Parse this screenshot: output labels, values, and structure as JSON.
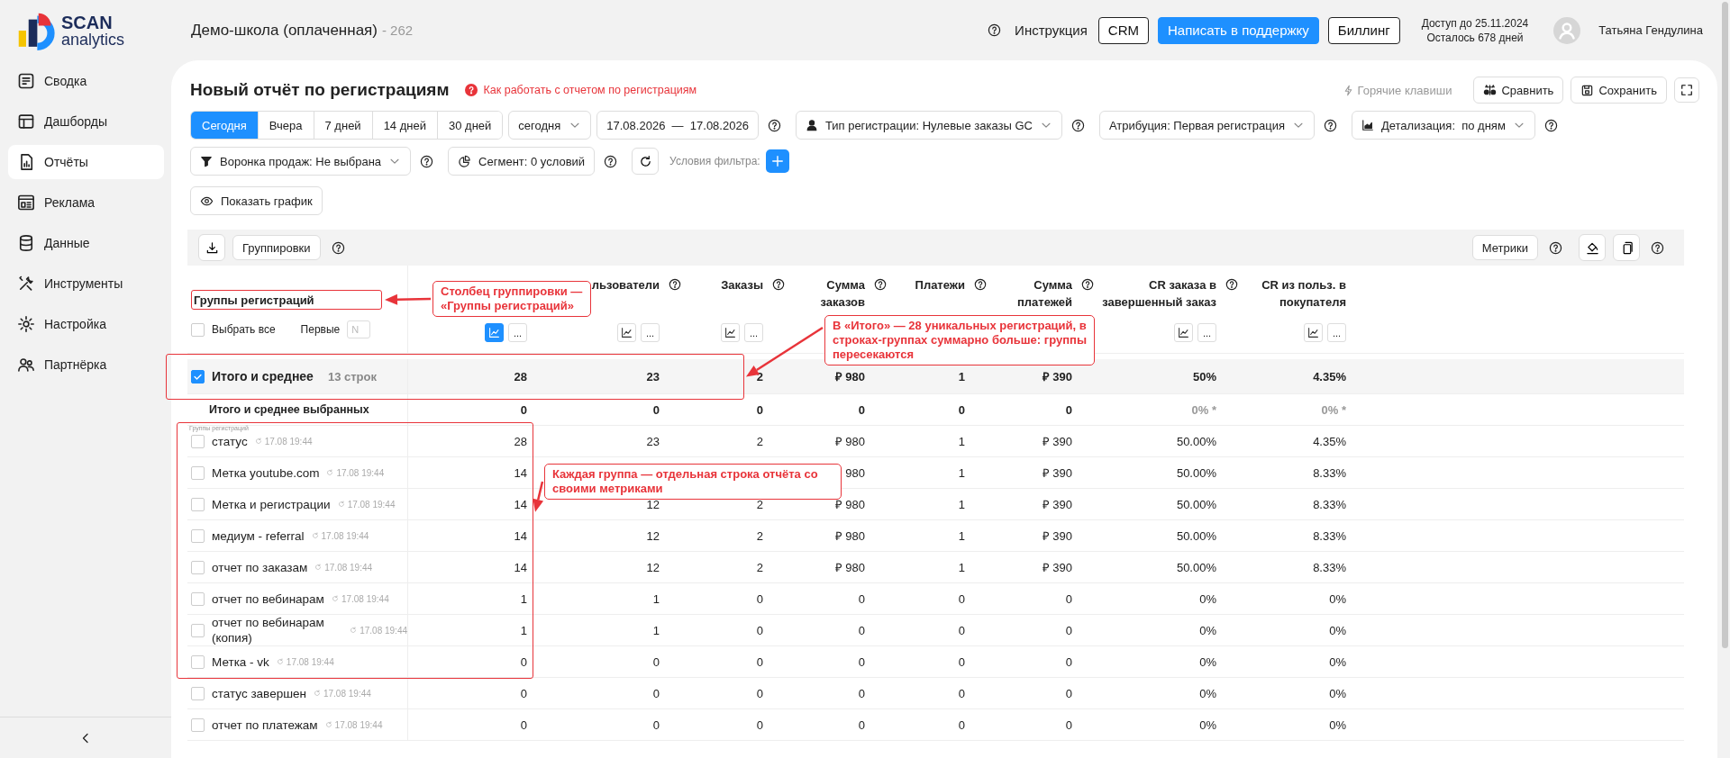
{
  "logo": {
    "line1": "SCAN",
    "line2": "analytics"
  },
  "header": {
    "workspace": "Демо-школа (оплаченная)",
    "workspace_id": "- 262",
    "help_link": "Инструкция",
    "buttons": [
      {
        "label": "CRM",
        "kind": "outline"
      },
      {
        "label": "Написать в поддержку",
        "kind": "primary"
      },
      {
        "label": "Биллинг",
        "kind": "outline"
      }
    ],
    "access": [
      "Доступ до 25.11.2024",
      "Осталось 678 дней"
    ],
    "user": "Татьяна Гендулина"
  },
  "sidebar": {
    "items": [
      {
        "label": "Сводка",
        "kind": "summary",
        "selected": false
      },
      {
        "label": "Дашборды",
        "kind": "dashboard",
        "selected": false
      },
      {
        "label": "Отчёты",
        "kind": "reports",
        "selected": true
      },
      {
        "label": "Реклама",
        "kind": "ads",
        "selected": false
      },
      {
        "label": "Данные",
        "kind": "data",
        "selected": false
      },
      {
        "label": "Инструменты",
        "kind": "tools",
        "selected": false
      },
      {
        "label": "Настройка",
        "kind": "settings",
        "selected": false
      },
      {
        "label": "Партнёрка",
        "kind": "partner",
        "selected": false
      }
    ]
  },
  "report": {
    "title": "Новый отчёт по регистрациям",
    "help_link": "Как работать с отчетом по регистрациям",
    "hotkeys": "Горячие клавиши",
    "actions": [
      {
        "label": "Сравнить",
        "kind": "compare"
      },
      {
        "label": "Сохранить",
        "kind": "save"
      }
    ]
  },
  "filter_rows": [
    [
      {
        "kind": "segmented",
        "options": [
          {
            "label": "Сегодня",
            "selected": true
          },
          {
            "label": "Вчера",
            "selected": false
          },
          {
            "label": "7 дней",
            "selected": false
          },
          {
            "label": "14 дней",
            "selected": false
          },
          {
            "label": "30 дней",
            "selected": false
          }
        ]
      },
      {
        "kind": "select",
        "label": "сегодня"
      },
      {
        "kind": "dates",
        "label": "17.08.2026  —  17.08.2026"
      },
      {
        "kind": "help"
      },
      {
        "kind": "registration_type",
        "label": "Тип регистрации: Нулевые заказы GC"
      },
      {
        "kind": "help"
      },
      {
        "kind": "attribution",
        "label": "Атрибуция: Первая регистрация"
      },
      {
        "kind": "help"
      },
      {
        "kind": "detail",
        "label": "Детализация:  по дням"
      },
      {
        "kind": "help"
      }
    ],
    [
      {
        "kind": "funnel",
        "label": "Воронка продаж: Не выбрана"
      },
      {
        "kind": "help"
      },
      {
        "kind": "segment",
        "label": "Сегмент: 0 условий"
      },
      {
        "kind": "help"
      },
      {
        "kind": "reset"
      },
      {
        "kind": "caption",
        "label": "Условия фильтра:"
      },
      {
        "kind": "add"
      }
    ],
    [
      {
        "kind": "chart_toggle",
        "label": "Показать график"
      }
    ]
  ],
  "table_toolbar": {
    "left": [
      {
        "kind": "download"
      },
      {
        "kind": "groupings",
        "label": "Группировки"
      },
      {
        "kind": "help"
      }
    ],
    "right": [
      {
        "kind": "metrics",
        "label": "Метрики"
      },
      {
        "kind": "help"
      },
      {
        "kind": "paint"
      },
      {
        "kind": "copy"
      },
      {
        "kind": "help"
      }
    ]
  },
  "table": {
    "group_header": {
      "title": "Группы регистраций",
      "select_all": "Выбрать все",
      "select_all_checked": false,
      "first_label": "Первые",
      "first_placeholder": "N"
    },
    "columns": [
      {
        "help": false,
        "toolbar": true,
        "chart_active": true,
        "more": "..."
      },
      {
        "title": "льзователи",
        "help": false,
        "toolbar": true,
        "chart_active": false,
        "more": "..."
      },
      {
        "title": "Заказы",
        "help": true,
        "toolbar": true,
        "chart_active": false,
        "more": "..."
      },
      {
        "title": "Сумма заказов",
        "help": true,
        "toolbar": false
      },
      {
        "title": "Платежи",
        "help": true,
        "toolbar": false
      },
      {
        "title": "Сумма платежей",
        "help": true,
        "toolbar": false
      },
      {
        "title": "CR заказа в завершенный заказ",
        "help": true,
        "toolbar": true,
        "chart_active": false,
        "more": "..."
      },
      {
        "title": "CR из польз. в покупателя",
        "help": true,
        "toolbar": true,
        "chart_active": false,
        "more": "..."
      }
    ],
    "total": {
      "label": "Итого и среднее",
      "count": "13 строк",
      "checked": true,
      "values": [
        "28",
        "23",
        "2",
        "₽ 980",
        "1",
        "₽ 390",
        "50%",
        "4.35%"
      ]
    },
    "selected_total": {
      "label": "Итого и среднее выбранных",
      "values": [
        {
          "text": "0",
          "muted": false
        },
        {
          "text": "0",
          "muted": false
        },
        {
          "text": "0",
          "muted": false
        },
        {
          "text": "0",
          "muted": false
        },
        {
          "text": "0",
          "muted": false
        },
        {
          "text": "0",
          "muted": false
        },
        {
          "text": "0% *",
          "muted": true
        },
        {
          "text": "0% *",
          "muted": true
        }
      ]
    },
    "sticky_label": "Группы регистраций",
    "rows": [
      {
        "name": "статус",
        "time": "17.08 19:44",
        "checked": false,
        "covered": false,
        "values": [
          "28",
          "23",
          "2",
          "₽ 980",
          "1",
          "₽ 390",
          "50.00%",
          "4.35%"
        ]
      },
      {
        "name": "Метка youtube.com",
        "time": "17.08 19:44",
        "checked": false,
        "covered": true,
        "values": [
          "14",
          "980",
          "1",
          "₽ 390",
          "50.00%",
          "8.33%"
        ]
      },
      {
        "name": "Метка и регистрации",
        "time": "17.08 19:44",
        "checked": false,
        "covered": false,
        "values": [
          "14",
          "12",
          "2",
          "₽ 980",
          "1",
          "₽ 390",
          "50.00%",
          "8.33%"
        ]
      },
      {
        "name": "медиум - referral",
        "time": "17.08 19:44",
        "checked": false,
        "covered": false,
        "values": [
          "14",
          "12",
          "2",
          "₽ 980",
          "1",
          "₽ 390",
          "50.00%",
          "8.33%"
        ]
      },
      {
        "name": "отчет по заказам",
        "time": "17.08 19:44",
        "checked": false,
        "covered": false,
        "values": [
          "14",
          "12",
          "2",
          "₽ 980",
          "1",
          "₽ 390",
          "50.00%",
          "8.33%"
        ]
      },
      {
        "name": "отчет по вебинарам",
        "time": "17.08 19:44",
        "checked": false,
        "covered": false,
        "values": [
          "1",
          "1",
          "0",
          "0",
          "0",
          "0",
          "0%",
          "0%"
        ]
      },
      {
        "name": "отчет по вебинарам (копия)",
        "time": "17.08 19:44",
        "checked": false,
        "covered": false,
        "values": [
          "1",
          "1",
          "0",
          "0",
          "0",
          "0",
          "0%",
          "0%"
        ]
      },
      {
        "name": "Метка - vk",
        "time": "17.08 19:44",
        "checked": false,
        "covered": false,
        "values": [
          "0",
          "0",
          "0",
          "0",
          "0",
          "0",
          "0%",
          "0%"
        ]
      },
      {
        "name": "статус завершен",
        "time": "17.08 19:44",
        "checked": false,
        "covered": false,
        "values": [
          "0",
          "0",
          "0",
          "0",
          "0",
          "0",
          "0%",
          "0%"
        ]
      },
      {
        "name": "отчет по платежам",
        "time": "17.08 19:44",
        "checked": false,
        "covered": false,
        "values": [
          "0",
          "0",
          "0",
          "0",
          "0",
          "0",
          "0%",
          "0%"
        ]
      }
    ]
  },
  "annotations": [
    {
      "text": "Столбец группировки — «Группы регистраций»",
      "kind": "column"
    },
    {
      "text": "В «Итого» — 28 уникальных регистраций, в строках-группах суммарно больше: группы пересекаются",
      "kind": "total"
    },
    {
      "text": "Каждая группа — отдельная строка отчёта со своими метриками",
      "kind": "rows"
    }
  ]
}
